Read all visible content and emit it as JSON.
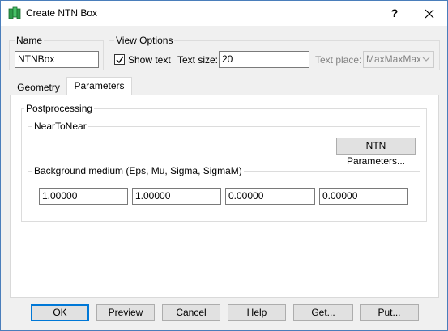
{
  "window": {
    "title": "Create NTN Box",
    "help_glyph": "?",
    "close_glyph": "✕"
  },
  "name_group": {
    "title": "Name",
    "value": "NTNBox"
  },
  "view_options": {
    "title": "View Options",
    "show_text_label": "Show text",
    "show_text_checked": true,
    "text_size_label": "Text size:",
    "text_size_value": "20",
    "text_place_label": "Text place:",
    "text_place_value": "MaxMaxMax"
  },
  "tabs": [
    {
      "label": "Geometry",
      "active": false
    },
    {
      "label": "Parameters",
      "active": true
    }
  ],
  "postprocessing": {
    "title": "Postprocessing",
    "near_to_near": {
      "title": "NearToNear",
      "button_label": "NTN Parameters..."
    },
    "background": {
      "title": "Background medium (Eps, Mu, Sigma, SigmaM)",
      "values": [
        "1.00000",
        "1.00000",
        "0.00000",
        "0.00000"
      ]
    }
  },
  "buttons": {
    "ok": "OK",
    "preview": "Preview",
    "cancel": "Cancel",
    "help": "Help",
    "get": "Get...",
    "put": "Put..."
  },
  "colors": {
    "accent": "#0078d7",
    "window_bg": "#f0f0f0",
    "border": "#4a7ebb"
  }
}
